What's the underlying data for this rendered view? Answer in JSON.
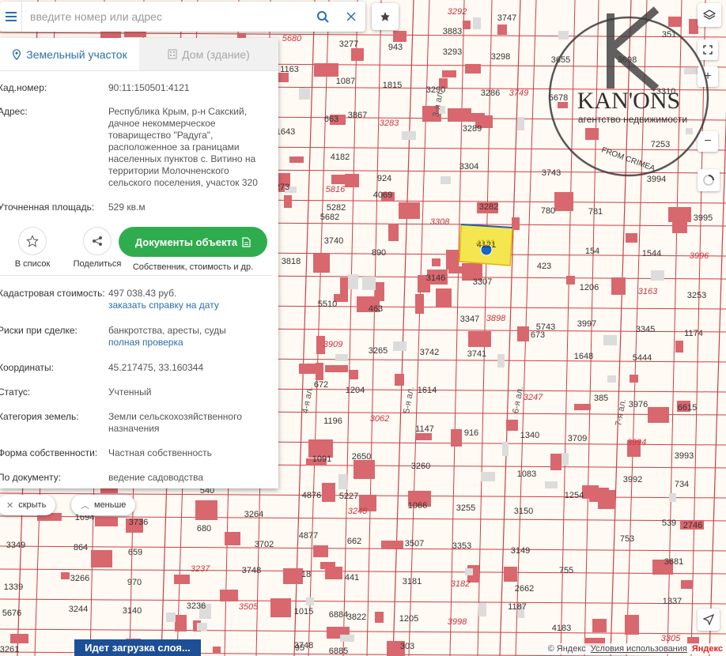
{
  "search": {
    "placeholder": "введите номер или адрес"
  },
  "tabs": [
    {
      "label": "Земельный участок",
      "icon": "map-marker-icon"
    },
    {
      "label": "Дом (здание)",
      "icon": "building-icon"
    }
  ],
  "info": {
    "cad_label": "Кад.номер:",
    "cad_value": "90:11:150501:4121",
    "addr_label": "Адрес:",
    "addr_value": "Республика Крым, р-н Сакский, дачное некоммерческое товарищество \"Радуга\", расположенное за границами населенных пунктов с. Витино на территории Молочненского сельского поселения, участок 320",
    "area_label": "Уточненная площадь:",
    "area_value": "529 кв.м",
    "cost_label": "Кадастровая стоимость:",
    "cost_value": "497 038.43 руб.",
    "cost_link": "заказать справку на дату",
    "risk_label": "Риски при сделке:",
    "risk_value": "банкротства, аресты, суды",
    "risk_link": "полная проверка",
    "coords_label": "Координаты:",
    "coords_value": "45.217475, 33.160344",
    "status_label": "Статус:",
    "status_value": "Учтенный",
    "category_label": "Категория земель:",
    "category_value": "Земли сельскохозяйственного назначения",
    "ownership_label": "Форма собственности:",
    "ownership_value": "Частная собственность",
    "usage_label": "По документу:",
    "usage_value": "ведение садоводства"
  },
  "actions": {
    "favorite": "В список",
    "share": "Поделиться",
    "docs_button": "Документы объекта",
    "docs_sub": "Собственник, стоимость и др."
  },
  "pills": {
    "hide": "скрыть",
    "less": "меньше"
  },
  "loading": "Идет загрузка слоя...",
  "footer": {
    "copyright": "© Яндекс",
    "terms": "Условия использования",
    "brand": "Яндекс"
  },
  "watermark": {
    "brand": "KAN'ONS",
    "subtitle": "агентство недвижимости",
    "tagline": "FROM CRIMEA"
  },
  "map": {
    "selected_parcel": "4121",
    "streets": [
      "4-я ал.",
      "5-я ал.",
      "6-я ал.",
      "7-я ал.",
      "3-я ал."
    ],
    "parcel_numbers": [
      "3292",
      "3747",
      "351",
      "3277",
      "943",
      "5680",
      "3883",
      "3293",
      "3298",
      "3655",
      "1163",
      "1087",
      "1815",
      "3290",
      "3286",
      "3749",
      "5678",
      "3310",
      "663",
      "3867",
      "3283",
      "3289",
      "3698",
      "1643",
      "7253",
      "4182",
      "3304",
      "3743",
      "924",
      "4069",
      "5816",
      "3994",
      "273",
      "5282",
      "3282",
      "780",
      "781",
      "3995",
      "5682",
      "3740",
      "3308",
      "4121",
      "423",
      "154",
      "1544",
      "3996",
      "890",
      "3146",
      "3307",
      "1206",
      "3163",
      "3253",
      "5510",
      "463",
      "3347",
      "3898",
      "5743",
      "3997",
      "3345",
      "1174",
      "3909",
      "3265",
      "3742",
      "3741",
      "673",
      "1648",
      "5444",
      "672",
      "1204",
      "1614",
      "3247",
      "385",
      "3976",
      "6615",
      "1196",
      "3062",
      "1147",
      "916",
      "1340",
      "3709",
      "3994",
      "3993",
      "1091",
      "2650",
      "3260",
      "1083",
      "3992",
      "734",
      "4876",
      "5227",
      "3248",
      "1066",
      "3255",
      "3150",
      "1254",
      "539",
      "2746",
      "3736",
      "680",
      "3264",
      "662",
      "3507",
      "3353",
      "3149",
      "753",
      "864",
      "659",
      "3702",
      "4877",
      "3681",
      "3237",
      "3748",
      "18",
      "441",
      "3181",
      "3182",
      "2662",
      "755",
      "1339",
      "3266",
      "970",
      "1337",
      "3244",
      "3140",
      "3236",
      "3505",
      "1015",
      "6884",
      "3822",
      "1205",
      "3998",
      "1187",
      "4183",
      "5676",
      "3349",
      "1694",
      "6885",
      "303",
      "95",
      "3261",
      "3305",
      "3748",
      "540",
      "3818"
    ]
  }
}
